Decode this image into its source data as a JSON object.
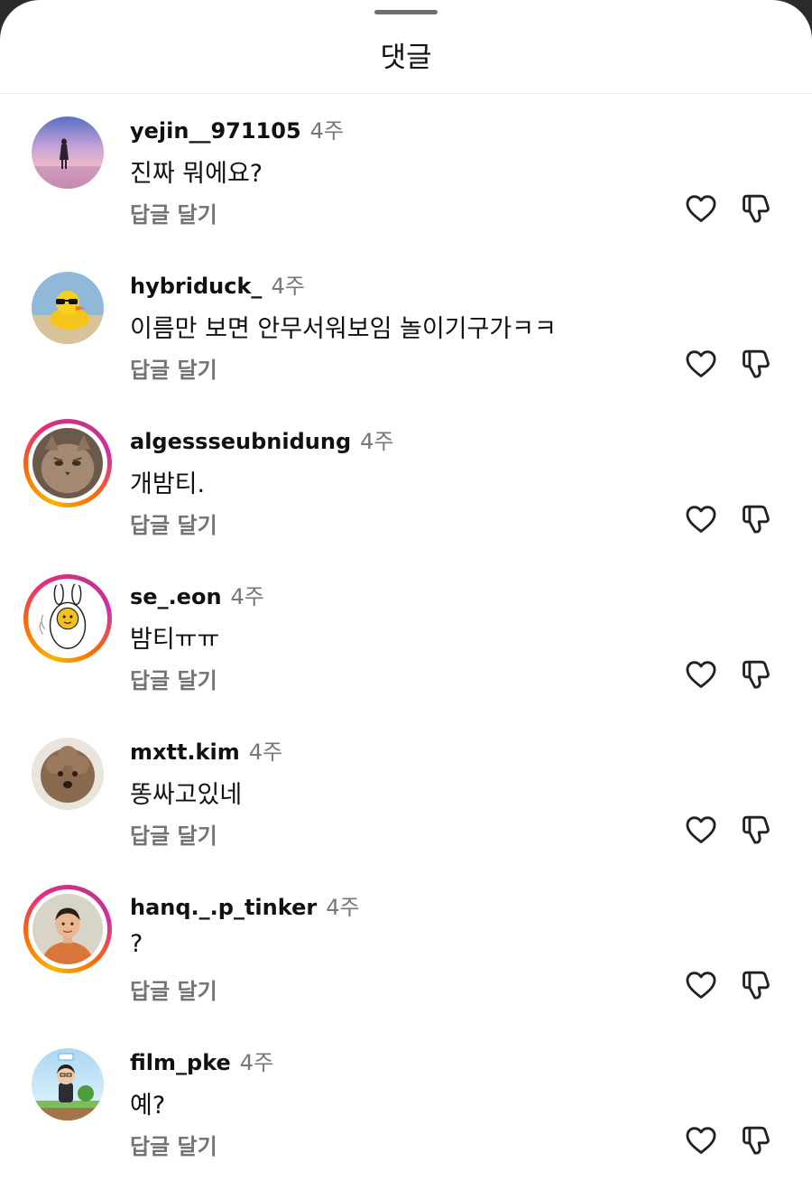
{
  "sheet": {
    "title": "댓글"
  },
  "comments": [
    {
      "username": "yejin__971105",
      "time": "4주",
      "text": "진짜 뭐에요?",
      "reply_label": "답글 달기",
      "story_ring": false,
      "avatar": "sunset-girl"
    },
    {
      "username": "hybriduck_",
      "time": "4주",
      "text": "이름만 보면 안무서워보임 놀이기구가ㅋㅋ",
      "reply_label": "답글 달기",
      "story_ring": false,
      "avatar": "rubber-duck"
    },
    {
      "username": "algessseubnidung",
      "time": "4주",
      "text": "개밤티.",
      "reply_label": "답글 달기",
      "story_ring": true,
      "avatar": "cat"
    },
    {
      "username": "se_.eon",
      "time": "4주",
      "text": "밤티ㅠㅠ",
      "reply_label": "답글 달기",
      "story_ring": true,
      "avatar": "cartoon-bunny"
    },
    {
      "username": "mxtt.kim",
      "time": "4주",
      "text": "똥싸고있네",
      "reply_label": "답글 달기",
      "story_ring": false,
      "avatar": "poodle"
    },
    {
      "username": "hanq._.p_tinker",
      "time": "4주",
      "text": "?",
      "reply_label": "답글 달기",
      "story_ring": true,
      "avatar": "man-portrait"
    },
    {
      "username": "film_pke",
      "time": "4주",
      "text": "예?",
      "reply_label": "답글 달기",
      "story_ring": false,
      "avatar": "game-character"
    }
  ],
  "icons": {
    "like": "heart-outline-icon",
    "dislike": "thumbs-down-outline-icon"
  },
  "colors": {
    "story_ring": [
      "#f7b500",
      "#ff6a00",
      "#ee2a7b",
      "#c13584"
    ],
    "secondary_text": "#737373"
  }
}
